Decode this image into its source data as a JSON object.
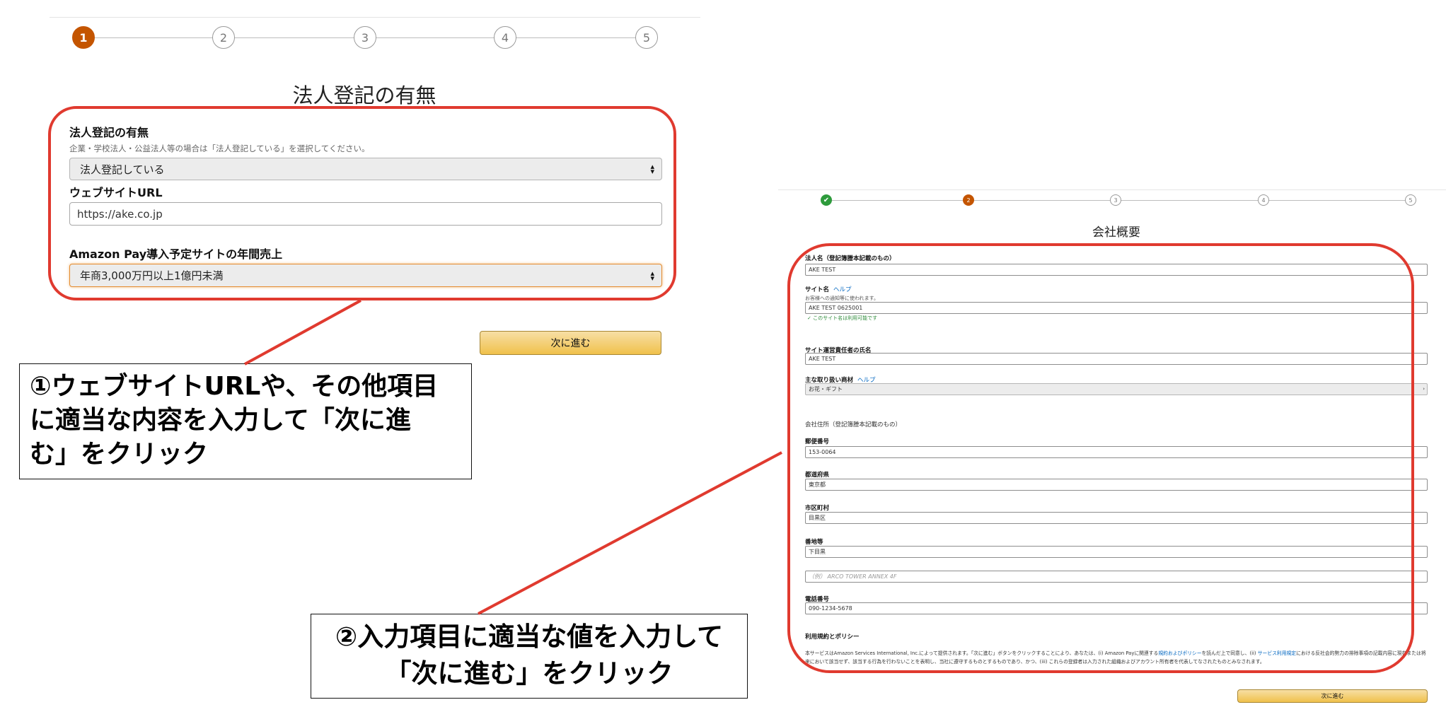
{
  "left": {
    "steps": [
      "1",
      "2",
      "3",
      "4",
      "5"
    ],
    "active_step": 1,
    "title": "法人登記の有無",
    "field1_label": "法人登記の有無",
    "field1_help": "企業・学校法人・公益法人等の場合は「法人登記している」を選択してください。",
    "field1_value": "法人登記している",
    "field2_label": "ウェブサイトURL",
    "field2_value": "https://ake.co.jp",
    "field3_label": "Amazon Pay導入予定サイトの年間売上",
    "field3_value": "年商3,000万円以上1億円未満",
    "next_button": "次に進む"
  },
  "callout1": {
    "line1": "①ウェブサイトURLや、その他項目",
    "line2": "に適当な内容を入力して「次に進",
    "line3": "む」をクリック"
  },
  "callout2": {
    "line1": "②入力項目に適当な値を入力して",
    "line2": "「次に進む」をクリック"
  },
  "right": {
    "steps": [
      "✔",
      "2",
      "3",
      "4",
      "5"
    ],
    "active_step": 2,
    "title": "会社概要",
    "corp_name_label": "法人名（登記簿謄本記載のもの）",
    "corp_name_value": "AKE TEST",
    "site_name_label": "サイト名",
    "site_name_help": "ヘルプ",
    "site_name_sub": "お客様への通知等に使われます。",
    "site_name_value": "AKE TEST 0625001",
    "site_name_ok": "✓ このサイト名は利用可能です",
    "manager_label": "サイト運営責任者の氏名",
    "manager_value": "AKE TEST",
    "products_label": "主な取り扱い商材",
    "products_help": "ヘルプ",
    "products_value": "お花・ギフト",
    "address_section": "会社住所（登記簿謄本記載のもの）",
    "zip_label": "郵便番号",
    "zip_value": "153-0064",
    "pref_label": "都道府県",
    "pref_value": "東京都",
    "city_label": "市区町村",
    "city_value": "目黒区",
    "block_label": "番地等",
    "block_value": "下目黒",
    "building_placeholder": "（例） ARCO TOWER ANNEX 4F",
    "phone_label": "電話番号",
    "phone_value": "090-1234-5678",
    "policy_label": "利用規約とポリシー",
    "policy_text_1": "本サービスはAmazon Services International, Inc.によって提供されます。「次に進む」ボタンをクリックすることにより、あなたは、(i) Amazon Payに関連する",
    "policy_link_1": "規約およびポリシー",
    "policy_text_2": "を読んだ上で同意し、(ii) ",
    "policy_link_2": "サービス利用規定",
    "policy_text_3": "における反社会的勢力の排除事項の記載内容に現在または将来において該当せず、該当する行為を行わないことを表明し、当社に遵守するものとするものであり、かつ、(iii) これらの登録者は入力された組織およびアカウント所有者を代表してなされたものとみなされます。",
    "next_button": "次に進む"
  },
  "colors": {
    "highlight_red": "#e03a2f",
    "step_active": "#c45500",
    "step_done": "#2e9b3c",
    "button_yellow": "#f0c14b",
    "link_blue": "#0066c0"
  }
}
